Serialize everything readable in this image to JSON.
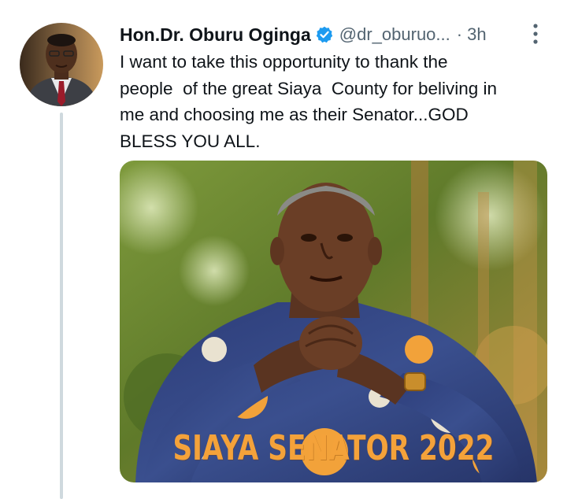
{
  "tweet": {
    "author_name": "Hon.Dr. Oburu Oginga",
    "handle": "@dr_oburuo...",
    "separator": "·",
    "time": "3h",
    "text": "I want to take this opportunity to thank the\npeople  of the great Siaya  County for beliving in\nme and choosing me as their Senator...GOD\nBLESS YOU ALL.",
    "media_caption": "SIAYA SENATOR 2022"
  },
  "icons": {
    "verified": "verified-badge-icon",
    "more": "more-options-icon"
  },
  "colors": {
    "accent": "#1d9bf0",
    "text": "#0f1419",
    "secondary": "#536471",
    "thread_line": "#cfd9de",
    "caption": "#f4a23a"
  }
}
